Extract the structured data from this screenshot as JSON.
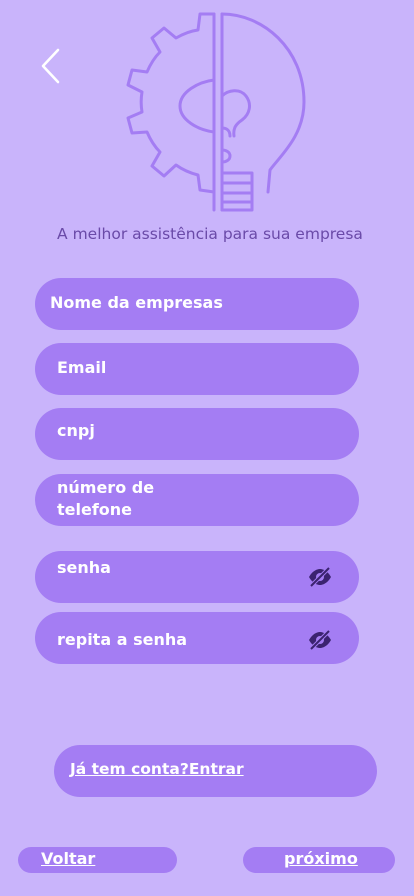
{
  "header": {
    "tagline": "A melhor assistência para sua empresa"
  },
  "form": {
    "company_name_label": "Nome da empresas",
    "email_label": "Email",
    "cnpj_label": "cnpj",
    "phone_label_line1": "número de",
    "phone_label_line2": "telefone",
    "password_label": "senha",
    "repeat_password_label": "repita a senha"
  },
  "links": {
    "login": "Já tem conta?Entrar"
  },
  "footer": {
    "back_label": "Voltar",
    "next_label": "próximo "
  },
  "icons": {
    "back": "chevron-left-icon",
    "logo": "gear-lightbulb-logo",
    "password_toggle": "eye-off-icon"
  },
  "colors": {
    "background": "#c9b4fb",
    "field": "#a47df3",
    "logo_stroke": "#a47df3",
    "tagline": "#6a4aa8",
    "text_on_field": "#ffffff"
  }
}
